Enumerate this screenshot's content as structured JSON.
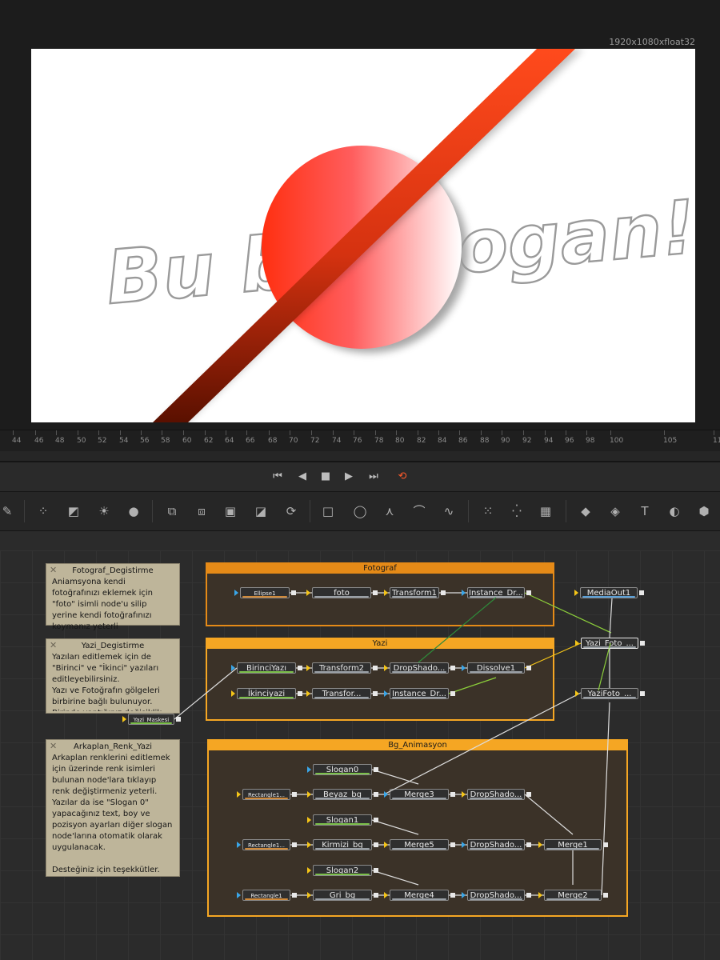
{
  "viewer": {
    "resolution": "1920x1080xfloat32",
    "canvas_text": "Bu bir Slogan!",
    "accent_colors": {
      "circle": "#ff3b1f",
      "bar": "#d93a12",
      "outline_text": "#9a9a9a"
    }
  },
  "timeline": {
    "ticks": [
      "44",
      "46",
      "48",
      "50",
      "52",
      "54",
      "56",
      "58",
      "60",
      "62",
      "64",
      "66",
      "68",
      "70",
      "72",
      "74",
      "76",
      "78",
      "80",
      "82",
      "84",
      "86",
      "88",
      "90",
      "92",
      "94",
      "96",
      "98",
      "100",
      "105",
      "11"
    ]
  },
  "transport": {
    "buttons": [
      {
        "name": "go-to-start",
        "icon": "skip-start-icon",
        "glyph": "⏮"
      },
      {
        "name": "play-reverse",
        "icon": "play-reverse-icon",
        "glyph": "◀"
      },
      {
        "name": "stop",
        "icon": "stop-icon",
        "glyph": "■"
      },
      {
        "name": "play-forward",
        "icon": "play-icon",
        "glyph": "▶"
      },
      {
        "name": "go-to-end",
        "icon": "skip-end-icon",
        "glyph": "⏭"
      },
      {
        "name": "loop",
        "icon": "loop-icon",
        "glyph": "⟲",
        "color": "#ff5a2a"
      }
    ]
  },
  "toolbar": {
    "tools": [
      {
        "icon": "paint-brush-icon",
        "glyph": "✎"
      },
      {
        "icon": "particles-icon",
        "glyph": "⁘"
      },
      {
        "icon": "curves-icon",
        "glyph": "◩"
      },
      {
        "icon": "brightness-icon",
        "glyph": "☀"
      },
      {
        "icon": "blur-drop-icon",
        "glyph": "●"
      },
      {
        "icon": "background-icon",
        "glyph": "⧉"
      },
      {
        "icon": "merge-icon",
        "glyph": "⧈"
      },
      {
        "icon": "channel-boolean-icon",
        "glyph": "▣"
      },
      {
        "icon": "matte-control-icon",
        "glyph": "◪"
      },
      {
        "icon": "loop-transform-icon",
        "glyph": "⟳"
      },
      {
        "icon": "rectangle-mask-icon",
        "glyph": "□"
      },
      {
        "icon": "ellipse-mask-icon",
        "glyph": "◯"
      },
      {
        "icon": "polygon-mask-icon",
        "glyph": "⋏"
      },
      {
        "icon": "bspline-mask-icon",
        "glyph": "⌒"
      },
      {
        "icon": "paint-stroke-icon",
        "glyph": "∿"
      },
      {
        "icon": "particle-emitter-icon",
        "glyph": "⁙"
      },
      {
        "icon": "particle-render-icon",
        "glyph": "⁛"
      },
      {
        "icon": "pixel-grid-icon",
        "glyph": "▦"
      },
      {
        "icon": "3d-plane-icon",
        "glyph": "◆"
      },
      {
        "icon": "3d-shapes-icon",
        "glyph": "◈"
      },
      {
        "icon": "3d-text-icon",
        "glyph": "T"
      },
      {
        "icon": "3d-merge-icon",
        "glyph": "◐"
      },
      {
        "icon": "3d-renderer-icon",
        "glyph": "⬢"
      }
    ]
  },
  "notes": [
    {
      "title": "Fotograf_Degistirme",
      "body": "Aniamsyona kendi fotoğrafınızı eklemek için \"foto\" isimli node'u silip yerine kendi fotoğrafınızı koymanız yeterli"
    },
    {
      "title": "Yazi_Degistirme",
      "body": "Yazıları editlemek için de \"Birinci\" ve \"İkinci\" yazıları editleyebilirsiniz.\nYazı ve Fotoğrafın gölgeleri birbirine bağlı bulunuyor. Birinde yaptığınız değişiklik"
    },
    {
      "title": "Arkaplan_Renk_Yazi",
      "body": "Arkaplan renklerini editlemek için üzerinde renk isimleri bulunan node'lara tıklayıp renk değiştirmeniz yeterli.\nYazılar da ise \"Slogan 0\" yapacağınız text, boy ve pozisyon ayarları diğer slogan node'larına otomatik olarak uygulanacak.\n\nDesteğiniz için teşekkütler."
    }
  ],
  "groups": [
    {
      "title": "Fotograf"
    },
    {
      "title": "Yazi"
    },
    {
      "title": "Bg_Animasyon"
    }
  ],
  "nodes": [
    {
      "label": "Ellipse1"
    },
    {
      "label": "foto"
    },
    {
      "label": "Transform1"
    },
    {
      "label": "Instance_Dr..."
    },
    {
      "label": "MediaOut1"
    },
    {
      "label": "Yazi_Foto_..."
    },
    {
      "label": "BirinciYazı"
    },
    {
      "label": "Transform2"
    },
    {
      "label": "DropShado..."
    },
    {
      "label": "Dissolve1"
    },
    {
      "label": "İkinciyazi"
    },
    {
      "label": "Transfor..."
    },
    {
      "label": "Instance_Dr..."
    },
    {
      "label": "Yazi_Maskesi"
    },
    {
      "label": "YaziFoto_..."
    },
    {
      "label": "Slogan0"
    },
    {
      "label": "Rectangle1..."
    },
    {
      "label": "Beyaz_bg"
    },
    {
      "label": "Merge3"
    },
    {
      "label": "DropShado..."
    },
    {
      "label": "Slogan1"
    },
    {
      "label": "Rectangle1..."
    },
    {
      "label": "Kirmizi_bg"
    },
    {
      "label": "Merge5"
    },
    {
      "label": "DropShado..."
    },
    {
      "label": "Merge1"
    },
    {
      "label": "Slogan2"
    },
    {
      "label": "Rectangle1"
    },
    {
      "label": "Gri_bg"
    },
    {
      "label": "Merge4"
    },
    {
      "label": "DropShado..."
    },
    {
      "label": "Merge2"
    }
  ]
}
